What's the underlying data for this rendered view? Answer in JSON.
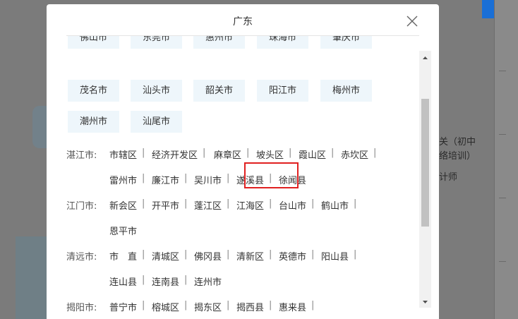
{
  "modal": {
    "title": "广东",
    "top_cities_partial": [
      "佛山市",
      "东莞市",
      "惠州市",
      "珠海市",
      "肇庆市"
    ],
    "cities_row2": [
      "茂名市",
      "汕头市",
      "韶关市",
      "阳江市",
      "梅州市"
    ],
    "cities_row3": [
      "潮州市",
      "汕尾市"
    ],
    "regions": [
      {
        "label": "湛江市:",
        "lines": [
          [
            "市辖区",
            "经济开发区",
            "麻章区",
            "坡头区",
            "霞山区",
            "赤坎区"
          ],
          [
            "雷州市",
            "廉江市",
            "吴川市",
            "遂溪县",
            "徐闻县"
          ]
        ]
      },
      {
        "label": "江门市:",
        "lines": [
          [
            "新会区",
            "开平市",
            "蓬江区",
            "江海区",
            "台山市",
            "鹤山市"
          ],
          [
            "恩平市"
          ]
        ]
      },
      {
        "label": "清远市:",
        "lines": [
          [
            "市　直",
            "清城区",
            "佛冈县",
            "清新区",
            "英德市",
            "阳山县"
          ],
          [
            "连山县",
            "连南县",
            "连州市"
          ]
        ]
      },
      {
        "label": "揭阳市:",
        "lines": [
          [
            "普宁市",
            "榕城区",
            "揭东区",
            "揭西县",
            "惠来县"
          ]
        ]
      }
    ],
    "separator": "|",
    "highlighted": "遂溪县"
  },
  "background": {
    "text_line1": "关（初中",
    "text_line2": "络培训）",
    "text_line3": "计师"
  },
  "colors": {
    "highlight_border": "#e02020",
    "chip_bg": "#eef6fb",
    "accent_blue": "#1a6fd6"
  }
}
